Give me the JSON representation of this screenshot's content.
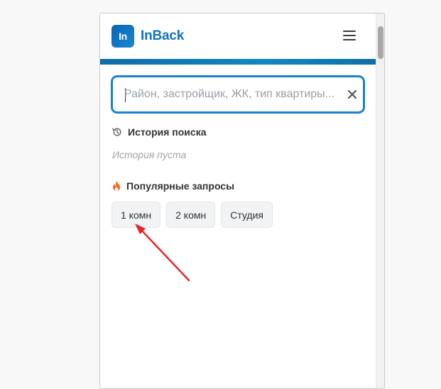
{
  "header": {
    "logo_mark": "In",
    "logo_text": "InBack",
    "brand_color": "#1474b9"
  },
  "search": {
    "placeholder": "Район, застройщик, ЖК, тип квартиры...",
    "value": ""
  },
  "history": {
    "title": "История поиска",
    "empty_text": "История пуста",
    "icon": "history-icon"
  },
  "popular": {
    "title": "Популярные запросы",
    "icon": "fire-icon",
    "chips": [
      {
        "label": "1 комн"
      },
      {
        "label": "2 комн"
      },
      {
        "label": "Студия"
      }
    ]
  },
  "annotation": {
    "type": "arrow",
    "color": "#e8272a",
    "points_to": "chip-1-komn"
  }
}
